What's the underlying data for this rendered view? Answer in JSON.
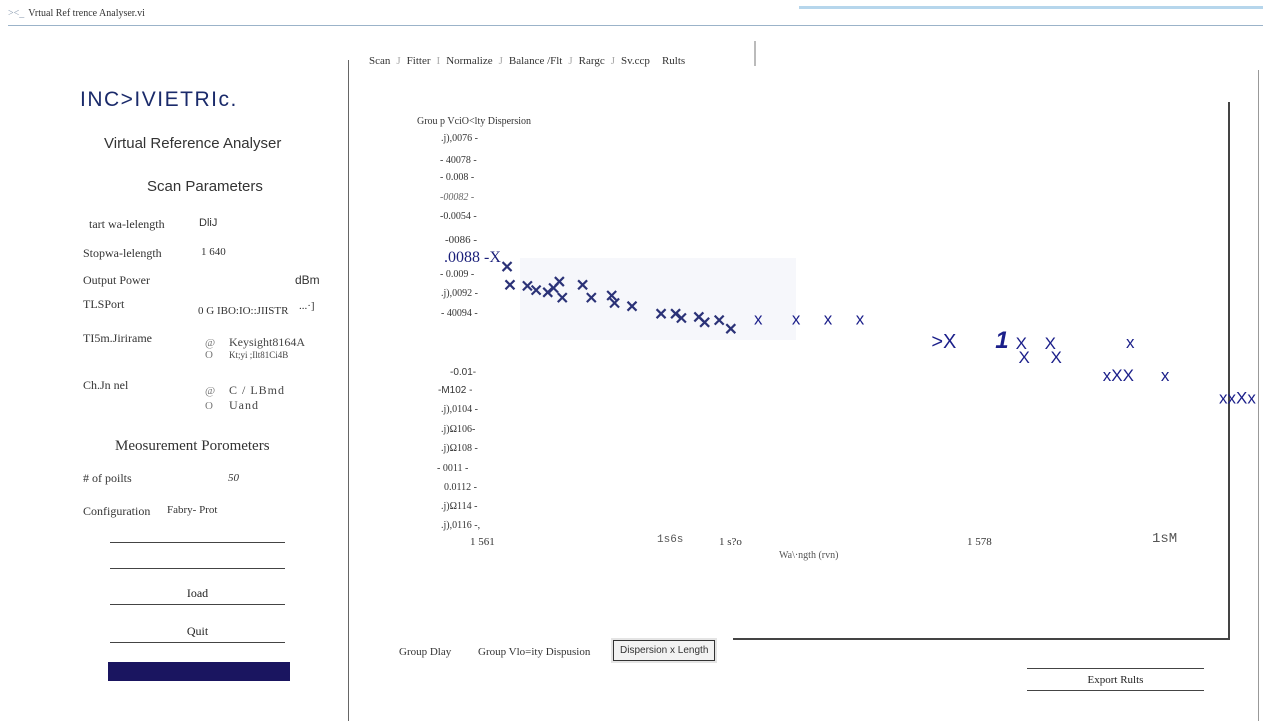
{
  "window": {
    "title": "Vrtual Ref trence Analyser.vi",
    "icon": "vi-icon"
  },
  "brand": {
    "logo_text": "INC>IVIETRIc.",
    "app_name": "Virtual Reference  Analyser"
  },
  "scan_parameters": {
    "heading": "Scan Parameters",
    "start_label": "tart wa-lelength",
    "start_value": "DliJ",
    "stop_label": "Stopwa-lelength",
    "stop_value": "1 640",
    "power_label": "Output Power",
    "power_unit": "dBm",
    "port_label": "TLSPort",
    "port_value": "0 G IBO:IO::JIISTR",
    "port_browse": "...·]",
    "frame_label": "TI5m.Jirirame",
    "frame_options": [
      {
        "marker": "@",
        "label": "Keysight8164A"
      },
      {
        "marker": "O",
        "label": "Kt;yi ;Ilt81Ci4B"
      }
    ],
    "channel_label": "Ch.Jn nel",
    "channel_options": [
      {
        "marker": "@",
        "label": "C / LBmd"
      },
      {
        "marker": "O",
        "label": "Uand"
      }
    ]
  },
  "measurement_parameters": {
    "heading": "Meosurement Porometers",
    "points_label": "# of poilts",
    "points_value": "50",
    "config_label": "Configuration",
    "config_value": "Fabry- Prot"
  },
  "buttons": {
    "load": "Ioad",
    "quit": "Quit",
    "export": "Export Rults"
  },
  "tabs": [
    "Scan",
    "Fitter",
    "Normalize",
    "Balance /Flt",
    "Rargc",
    "Sv.ccp",
    "Rults"
  ],
  "tab_separators": [
    "J",
    "I",
    "J",
    "J",
    "J"
  ],
  "bottom_tabs": [
    "Group  Dlay",
    "Group Vlo=ity Dispusion",
    "Dispersion x Length"
  ],
  "chart_data": {
    "type": "scatter",
    "ylabel": "Grou p VciO<lty Dispersion",
    "xlabel": "Wa\\·ngth (rvn)",
    "ytick_labels": [
      ".j),0076 -",
      "- 40078 -",
      "- 0.008 -",
      "-00082 -",
      "-0.0054 -",
      "-0086 -",
      ".0088 -X",
      "- 0.009 -",
      ".j),0092 -",
      "- 40094 -",
      "-0.01-",
      "-M102 -",
      ".j),0104 -",
      ".j)Ω106-",
      ".j)Ω108 -",
      "- 0011 -",
      "0.0112 -",
      ".j)Ω114 -",
      ".j),0116 -,"
    ],
    "xtick_labels": [
      "1 561",
      "1s6s",
      "1 s?o",
      "1 578",
      "1sM"
    ],
    "dense_cluster": [
      [
        1562.0,
        -0.00888
      ],
      [
        1562.1,
        -0.00905
      ],
      [
        1562.7,
        -0.00906
      ],
      [
        1563.0,
        -0.0091
      ],
      [
        1563.4,
        -0.00912
      ],
      [
        1563.6,
        -0.00908
      ],
      [
        1563.8,
        -0.00902
      ],
      [
        1563.9,
        -0.00917
      ],
      [
        1564.6,
        -0.00905
      ],
      [
        1564.9,
        -0.00917
      ],
      [
        1565.6,
        -0.00915
      ],
      [
        1565.7,
        -0.00922
      ],
      [
        1566.3,
        -0.00925
      ],
      [
        1567.3,
        -0.00932
      ],
      [
        1567.8,
        -0.00932
      ],
      [
        1568.0,
        -0.00936
      ],
      [
        1568.6,
        -0.00935
      ],
      [
        1568.8,
        -0.0094
      ],
      [
        1569.3,
        -0.00938
      ],
      [
        1569.7,
        -0.00946
      ]
    ],
    "sparse_points": [
      {
        "x": 1570.5,
        "y": -0.00942,
        "glyph": "x"
      },
      {
        "x": 1571.8,
        "y": -0.00942,
        "glyph": "x"
      },
      {
        "x": 1572.9,
        "y": -0.00942,
        "glyph": "x"
      },
      {
        "x": 1574.0,
        "y": -0.00942,
        "glyph": "x"
      },
      {
        "x": 1576.6,
        "y": -0.00964,
        "glyph": ">X"
      },
      {
        "x": 1578.8,
        "y": -0.00964,
        "glyph": "1"
      },
      {
        "x": 1579.5,
        "y": -0.00965,
        "glyph": "X"
      },
      {
        "x": 1579.6,
        "y": -0.00978,
        "glyph": "X"
      },
      {
        "x": 1580.5,
        "y": -0.00965,
        "glyph": "X"
      },
      {
        "x": 1580.7,
        "y": -0.00978,
        "glyph": "X"
      },
      {
        "x": 1583.3,
        "y": -0.00964,
        "glyph": "x"
      },
      {
        "x": 1582.5,
        "y": -0.00995,
        "glyph": "xXX"
      },
      {
        "x": 1584.5,
        "y": -0.00995,
        "glyph": "x"
      },
      {
        "x": 1586.5,
        "y": -0.01016,
        "glyph": "xxXx"
      }
    ],
    "colors": {
      "dense": "#2b3277",
      "sparse": "#1b1f8a"
    }
  }
}
